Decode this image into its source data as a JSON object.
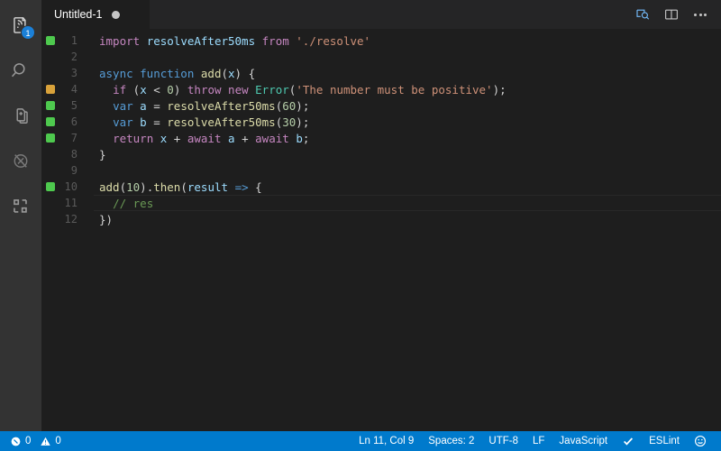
{
  "activity_bar": {
    "items": [
      {
        "name": "explorer-icon",
        "label": "Explorer",
        "badge": "1"
      },
      {
        "name": "search-icon",
        "label": "Search",
        "badge": ""
      },
      {
        "name": "source-control-icon",
        "label": "Source Control",
        "badge": ""
      },
      {
        "name": "run-debug-icon",
        "label": "Run and Debug",
        "badge": ""
      },
      {
        "name": "extensions-icon",
        "label": "Extensions",
        "badge": ""
      }
    ]
  },
  "tab": {
    "title": "Untitled-1",
    "dirty": true
  },
  "title_actions": [
    {
      "name": "open-preview-icon",
      "label": "Open Preview"
    },
    {
      "name": "split-editor-icon",
      "label": "Split Editor"
    },
    {
      "name": "more-actions-icon",
      "label": "More Actions..."
    }
  ],
  "editor": {
    "language": "JavaScript",
    "current_line": 11,
    "lines": [
      {
        "num": "1",
        "coverage": "covered",
        "tokens": [
          {
            "t": "import ",
            "c": "t-kw"
          },
          {
            "t": "resolveAfter50ms",
            "c": "t-var"
          },
          {
            "t": " ",
            "c": "t-pl"
          },
          {
            "t": "from",
            "c": "t-kw"
          },
          {
            "t": " ",
            "c": "t-pl"
          },
          {
            "t": "'./resolve'",
            "c": "t-str"
          }
        ]
      },
      {
        "num": "2",
        "coverage": "",
        "tokens": []
      },
      {
        "num": "3",
        "coverage": "",
        "tokens": [
          {
            "t": "async function ",
            "c": "t-ctl"
          },
          {
            "t": "add",
            "c": "t-fn"
          },
          {
            "t": "(",
            "c": "t-pl"
          },
          {
            "t": "x",
            "c": "t-var"
          },
          {
            "t": ") {",
            "c": "t-pl"
          }
        ]
      },
      {
        "num": "4",
        "coverage": "partial",
        "tokens": [
          {
            "t": "  ",
            "c": "t-pl"
          },
          {
            "t": "if",
            "c": "t-kw"
          },
          {
            "t": " (",
            "c": "t-pl"
          },
          {
            "t": "x",
            "c": "t-var"
          },
          {
            "t": " < ",
            "c": "t-pl"
          },
          {
            "t": "0",
            "c": "t-num"
          },
          {
            "t": ") ",
            "c": "t-pl"
          },
          {
            "t": "throw new ",
            "c": "t-kw"
          },
          {
            "t": "Error",
            "c": "t-type"
          },
          {
            "t": "(",
            "c": "t-pl"
          },
          {
            "t": "'The number must be positive'",
            "c": "t-str"
          },
          {
            "t": ");",
            "c": "t-pl"
          }
        ]
      },
      {
        "num": "5",
        "coverage": "covered",
        "tokens": [
          {
            "t": "  ",
            "c": "t-pl"
          },
          {
            "t": "var",
            "c": "t-ctl"
          },
          {
            "t": " a ",
            "c": "t-var"
          },
          {
            "t": "= ",
            "c": "t-pl"
          },
          {
            "t": "resolveAfter50ms",
            "c": "t-fn"
          },
          {
            "t": "(",
            "c": "t-pl"
          },
          {
            "t": "60",
            "c": "t-num"
          },
          {
            "t": ");",
            "c": "t-pl"
          }
        ]
      },
      {
        "num": "6",
        "coverage": "covered",
        "tokens": [
          {
            "t": "  ",
            "c": "t-pl"
          },
          {
            "t": "var",
            "c": "t-ctl"
          },
          {
            "t": " b ",
            "c": "t-var"
          },
          {
            "t": "= ",
            "c": "t-pl"
          },
          {
            "t": "resolveAfter50ms",
            "c": "t-fn"
          },
          {
            "t": "(",
            "c": "t-pl"
          },
          {
            "t": "30",
            "c": "t-num"
          },
          {
            "t": ");",
            "c": "t-pl"
          }
        ]
      },
      {
        "num": "7",
        "coverage": "covered",
        "tokens": [
          {
            "t": "  ",
            "c": "t-pl"
          },
          {
            "t": "return",
            "c": "t-kw"
          },
          {
            "t": " ",
            "c": "t-pl"
          },
          {
            "t": "x",
            "c": "t-var"
          },
          {
            "t": " + ",
            "c": "t-pl"
          },
          {
            "t": "await",
            "c": "t-kw"
          },
          {
            "t": " ",
            "c": "t-pl"
          },
          {
            "t": "a",
            "c": "t-var"
          },
          {
            "t": " + ",
            "c": "t-pl"
          },
          {
            "t": "await",
            "c": "t-kw"
          },
          {
            "t": " ",
            "c": "t-pl"
          },
          {
            "t": "b",
            "c": "t-var"
          },
          {
            "t": ";",
            "c": "t-pl"
          }
        ]
      },
      {
        "num": "8",
        "coverage": "",
        "tokens": [
          {
            "t": "}",
            "c": "t-pl"
          }
        ]
      },
      {
        "num": "9",
        "coverage": "",
        "tokens": []
      },
      {
        "num": "10",
        "coverage": "covered",
        "tokens": [
          {
            "t": "add",
            "c": "t-fn"
          },
          {
            "t": "(",
            "c": "t-pl"
          },
          {
            "t": "10",
            "c": "t-num"
          },
          {
            "t": ").",
            "c": "t-pl"
          },
          {
            "t": "then",
            "c": "t-fn"
          },
          {
            "t": "(",
            "c": "t-pl"
          },
          {
            "t": "result",
            "c": "t-var"
          },
          {
            "t": " ",
            "c": "t-pl"
          },
          {
            "t": "=>",
            "c": "t-ctl"
          },
          {
            "t": " {",
            "c": "t-pl"
          }
        ]
      },
      {
        "num": "11",
        "coverage": "",
        "tokens": [
          {
            "t": "  ",
            "c": "t-pl"
          },
          {
            "t": "// res",
            "c": "t-cmt"
          }
        ]
      },
      {
        "num": "12",
        "coverage": "",
        "tokens": [
          {
            "t": "})",
            "c": "t-pl"
          }
        ]
      }
    ]
  },
  "status_bar": {
    "errors": "0",
    "warnings": "0",
    "cursor_position": "Ln 11, Col 9",
    "indentation": "Spaces: 2",
    "encoding": "UTF-8",
    "eol": "LF",
    "language_mode": "JavaScript",
    "eslint": "ESLint",
    "background_color": "#007acc"
  },
  "colors": {
    "coverage_covered": "#4ec94e",
    "coverage_partial": "#d9a23a",
    "editor_background": "#1e1e1e",
    "activitybar_background": "#333333",
    "badge_background": "#1b80d8"
  }
}
